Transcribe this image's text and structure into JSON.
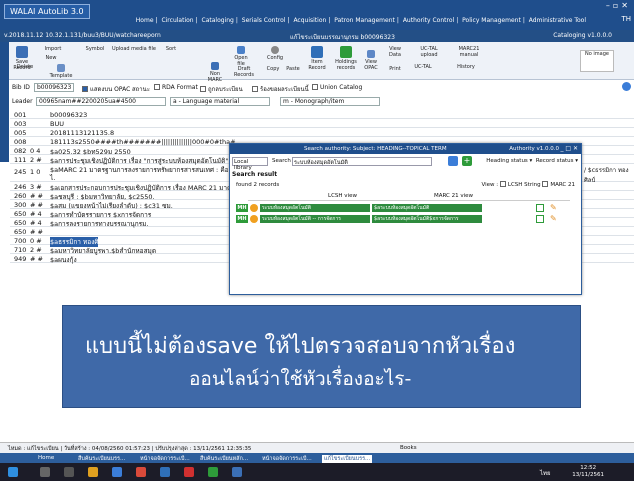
{
  "title": {
    "app": "WALAI AutoLib 3.0",
    "nav": [
      "Home",
      "Circulation",
      "Cataloging",
      "Serials Control",
      "Acquisition",
      "Patron Management",
      "Authority Control",
      "Policy Management",
      "Administrative Tool"
    ],
    "user": "TH"
  },
  "pathbar": {
    "left": "v.2018.11.12   10.32.1.131/buu3/BUU/watchareeporn",
    "middle": "แก้ไขระเบียนบรรณานุกรม b00096323",
    "right": "Cataloging v1.0.0.0"
  },
  "ribbon": {
    "buttons": [
      "Save Record",
      "Delete",
      "Import",
      "New",
      "Template",
      "Symbol",
      "Upload media file",
      "Sort",
      "Non MARC",
      "Open file",
      "Draft Records",
      "Config",
      "Copy",
      "Paste",
      "Item Record",
      "Holdings records",
      "View OPAC",
      "View Data",
      "Print",
      "UC-TAL upload",
      "UC-TAL",
      "MARC21 manual",
      "History",
      "No image"
    ]
  },
  "optbar": {
    "bibid_label": "Bib ID",
    "bibid": "b00096323",
    "opac": "แสดงบน OPAC",
    "status_label": "สถานะ",
    "rda": "RDA Format",
    "lock": "ถูกลบระเบียน",
    "union_thai": "ร้องขอผลระเบียนนี้",
    "union": "Union Catalog"
  },
  "leader": {
    "label": "Leader",
    "value": "00965nam##2200205ua#4500",
    "type": "a - Language material",
    "level": "m - Monograph/item"
  },
  "fields": [
    {
      "tag": "001",
      "ind": "",
      "val": "b00096323"
    },
    {
      "tag": "003",
      "ind": "",
      "val": "BUU"
    },
    {
      "tag": "005",
      "ind": "",
      "val": "20181113121135.8"
    },
    {
      "tag": "008",
      "ind": "",
      "val": "181113s2550####th#######||||||||||||||000#0#tha#"
    },
    {
      "tag": "082",
      "ind": "0 4",
      "val": "$a025.32 $bท529ม 2550"
    },
    {
      "tag": "111",
      "ind": "2 #",
      "val": "$aการประชุมเชิงปฏิบัติการ เรื่อง \"การสู่ระบบห้องสมุดอัตโนมัติ\" ($d2550 :$cจังหวัดชลบุรี"
    },
    {
      "tag": "245",
      "ind": "1 0",
      "val": "$aMARC 21 มาตรฐานการลงรายการทรัพยากรสารสนเทศ : คือ"
    },
    {
      "tag": "246",
      "ind": "3 #",
      "val": "$aเอกสารประกอบการประชุมเชิงปฏิบัติการ เรื่อง MARC 21 มาตรฐาน"
    },
    {
      "tag": "260",
      "ind": "# #",
      "val": "$aชลบุรี : $bมหาวิทยาลัย, $c2550."
    },
    {
      "tag": "300",
      "ind": "# #",
      "val": "$aสม (แขยงหน้าไม่เรียงลำดับ) : $c31 ซม."
    },
    {
      "tag": "650",
      "ind": "# 4",
      "val": "$aการทำบัตรรายการ $xการจัดการ"
    },
    {
      "tag": "650",
      "ind": "# 4",
      "val": "$aการลงรายการทางบรรณานุกรม."
    },
    {
      "tag": "650",
      "ind": "# #",
      "val": ""
    },
    {
      "tag": "700",
      "ind": "0 #",
      "val": "$aธรรมิกา ทองศิลป์."
    },
    {
      "tag": "710",
      "ind": "2 #",
      "val": "$aมหาวิทยาลัยบูรพา.$bสำนักหอสมุด"
    },
    {
      "tag": "949",
      "ind": "# #",
      "val": "$aผนงกุ้ง"
    }
  ],
  "field_245_extra": "/ $cธรรมิกา ทองศิลป์",
  "dialog": {
    "title": "Search authority: Subject: HEADING--TOPICAL TERM",
    "version": "Authority v1.0.0.0",
    "library": "Local library",
    "search_label": "Search",
    "search_value": "ระบบห้องสมุดอัตโนมัติ",
    "heading_status": "Heading status",
    "record_status": "Record status",
    "result_title": "Search result",
    "found": "found 2 records",
    "view_label": "View :",
    "view_lcsh": "LCSH String",
    "view_marc": "MARC 21",
    "col_lcsh": "LCSH view",
    "col_marc": "MARC 21 view",
    "rows": [
      {
        "badge": "MH",
        "lcsh": "ระบบห้องสมุดอัตโนมัติ",
        "marc": "$aระบบห้องสมุดอัตโนมัติ"
      },
      {
        "badge": "MH",
        "lcsh": "ระบบห้องสมุดอัตโนมัติ -- การจัดการ",
        "marc": "$aระบบห้องสมุดอัตโนมัติ$xการจัดการ"
      }
    ]
  },
  "overlay": {
    "line1": "แบบนี้ไม่ต้องsave  ให้ไปตรวจสอบจากหัวเรื่อง",
    "line2": "ออนไลน์ว่าใช้หัวเรื่องอะไร-"
  },
  "statusbar": {
    "left": "ไหมด : แก้ไขระเบียน | วันที่สร้าง : 04/08/2560 01:57:23 | ปรับปรุงล่าสุด : 13/11/2561 12:35:35",
    "right": "Books"
  },
  "tabs": [
    "Home",
    "สืบค้นระเบียนบรร...",
    "หน้าจอจัดการระเบี...",
    "สืบค้นระเบียนหลัก...",
    "หน้าจอจัดการระเบี...",
    "แก้ไขระเบียนบรร..."
  ],
  "taskbar": {
    "time": "12:52",
    "date": "13/11/2561",
    "lang": "ไทย"
  }
}
